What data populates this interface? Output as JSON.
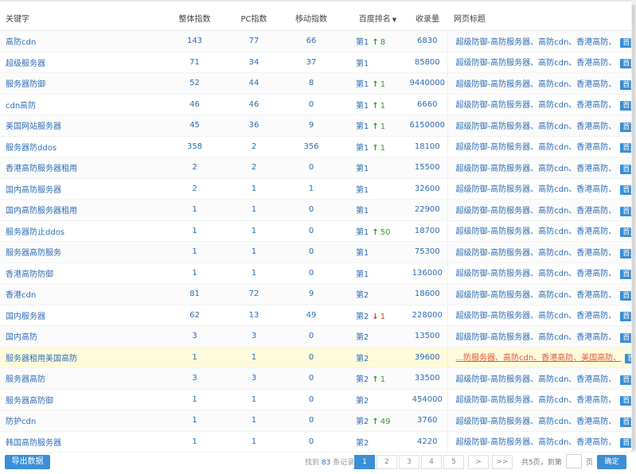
{
  "columns": {
    "keyword": "关键字",
    "total_index": "整体指数",
    "pc_index": "PC指数",
    "mobile_index": "移动指数",
    "baidu_rank": "百度排名",
    "indexed": "收录量",
    "page_title": "网页标题"
  },
  "rows": [
    {
      "kw": "高防cdn",
      "total": "143",
      "pc": "77",
      "mobile": "66",
      "rank": "第1",
      "dir": "up",
      "chg": "8",
      "indexed": "6830",
      "title": "超级防御-高防服务器、高防cdn、香港高防、",
      "link": "首页"
    },
    {
      "kw": "超级服务器",
      "total": "71",
      "pc": "34",
      "mobile": "37",
      "rank": "第1",
      "dir": "",
      "chg": "",
      "indexed": "85800",
      "title": "超级防御-高防服务器、高防cdn、香港高防、",
      "link": "首页"
    },
    {
      "kw": "服务器防御",
      "total": "52",
      "pc": "44",
      "mobile": "8",
      "rank": "第1",
      "dir": "up",
      "chg": "1",
      "indexed": "9440000",
      "title": "超级防御-高防服务器、高防cdn、香港高防、",
      "link": "首页"
    },
    {
      "kw": "cdn高防",
      "total": "46",
      "pc": "46",
      "mobile": "0",
      "rank": "第1",
      "dir": "up",
      "chg": "1",
      "indexed": "6660",
      "title": "超级防御-高防服务器、高防cdn、香港高防、",
      "link": "首页"
    },
    {
      "kw": "美国网站服务器",
      "total": "45",
      "pc": "36",
      "mobile": "9",
      "rank": "第1",
      "dir": "up",
      "chg": "1",
      "indexed": "6150000",
      "title": "超级防御-高防服务器、高防cdn、香港高防、",
      "link": "首页"
    },
    {
      "kw": "服务器防ddos",
      "total": "358",
      "pc": "2",
      "mobile": "356",
      "rank": "第1",
      "dir": "up",
      "chg": "1",
      "indexed": "18100",
      "title": "超级防御-高防服务器、高防cdn、香港高防、",
      "link": "首页"
    },
    {
      "kw": "香港高防服务器租用",
      "total": "2",
      "pc": "2",
      "mobile": "0",
      "rank": "第1",
      "dir": "",
      "chg": "",
      "indexed": "15500",
      "title": "超级防御-高防服务器、高防cdn、香港高防、",
      "link": "首页"
    },
    {
      "kw": "国内高防服务器",
      "total": "2",
      "pc": "1",
      "mobile": "1",
      "rank": "第1",
      "dir": "",
      "chg": "",
      "indexed": "32600",
      "title": "超级防御-高防服务器、高防cdn、香港高防、",
      "link": "首页"
    },
    {
      "kw": "国内高防服务器租用",
      "total": "1",
      "pc": "1",
      "mobile": "0",
      "rank": "第1",
      "dir": "",
      "chg": "",
      "indexed": "22900",
      "title": "超级防御-高防服务器、高防cdn、香港高防、",
      "link": "首页"
    },
    {
      "kw": "服务器防止ddos",
      "total": "1",
      "pc": "1",
      "mobile": "0",
      "rank": "第1",
      "dir": "up",
      "chg": "50",
      "indexed": "18700",
      "title": "超级防御-高防服务器、高防cdn、香港高防、",
      "link": "首页"
    },
    {
      "kw": "服务器高防服务",
      "total": "1",
      "pc": "1",
      "mobile": "0",
      "rank": "第1",
      "dir": "",
      "chg": "",
      "indexed": "75300",
      "title": "超级防御-高防服务器、高防cdn、香港高防、",
      "link": "首页"
    },
    {
      "kw": "香港高防防御",
      "total": "1",
      "pc": "1",
      "mobile": "0",
      "rank": "第1",
      "dir": "",
      "chg": "",
      "indexed": "136000",
      "title": "超级防御-高防服务器、高防cdn、香港高防、",
      "link": "首页"
    },
    {
      "kw": "香港cdn",
      "total": "81",
      "pc": "72",
      "mobile": "9",
      "rank": "第2",
      "dir": "",
      "chg": "",
      "indexed": "18600",
      "title": "超级防御-高防服务器、高防cdn、香港高防、",
      "link": "首页"
    },
    {
      "kw": "国内服务器",
      "total": "62",
      "pc": "13",
      "mobile": "49",
      "rank": "第2",
      "dir": "down",
      "chg": "1",
      "indexed": "228000",
      "title": "超级防御-高防服务器、高防cdn、香港高防、",
      "link": "首页"
    },
    {
      "kw": "国内高防",
      "total": "3",
      "pc": "3",
      "mobile": "0",
      "rank": "第2",
      "dir": "",
      "chg": "",
      "indexed": "13500",
      "title": "超级防御-高防服务器、高防cdn、香港高防、",
      "link": "首页"
    },
    {
      "kw": "服务器租用美国高防",
      "total": "1",
      "pc": "1",
      "mobile": "0",
      "rank": "第2",
      "dir": "",
      "chg": "",
      "indexed": "39600",
      "title": "...防服务器、高防cdn、香港高防、美国高防、",
      "link": "首页",
      "highlight": true
    },
    {
      "kw": "服务器高防",
      "total": "3",
      "pc": "3",
      "mobile": "0",
      "rank": "第2",
      "dir": "up",
      "chg": "1",
      "indexed": "33500",
      "title": "超级防御-高防服务器、高防cdn、香港高防、",
      "link": "首页"
    },
    {
      "kw": "服务器高防御",
      "total": "1",
      "pc": "1",
      "mobile": "0",
      "rank": "第2",
      "dir": "",
      "chg": "",
      "indexed": "454000",
      "title": "超级防御-高防服务器、高防cdn、香港高防、",
      "link": "首页"
    },
    {
      "kw": "防护cdn",
      "total": "1",
      "pc": "1",
      "mobile": "0",
      "rank": "第2",
      "dir": "up",
      "chg": "49",
      "indexed": "3760",
      "title": "超级防御-高防服务器、高防cdn、香港高防、",
      "link": "首页"
    },
    {
      "kw": "韩国高防服务器",
      "total": "1",
      "pc": "1",
      "mobile": "0",
      "rank": "第2",
      "dir": "",
      "chg": "",
      "indexed": "4220",
      "title": "超级防御-高防服务器、高防cdn、香港高防、",
      "link": "首页"
    }
  ],
  "footer": {
    "export_label": "导出数据",
    "found_prefix": "找到",
    "found_count": "83",
    "found_suffix": "条记录",
    "pages": [
      "1",
      "2",
      "3",
      "4",
      "5",
      ">",
      ">>"
    ],
    "active_page": "1",
    "total_pages_text": "共5页，到第",
    "page_word": "页",
    "goto_value": "",
    "confirm_label": "确定"
  },
  "icons": {
    "sort": "sort-desc-icon",
    "rank_up": "arrow-up-icon",
    "rank_down": "arrow-down-icon"
  },
  "colors": {
    "accent": "#3a8fd6",
    "link": "#2d6cb4",
    "up": "#2e9b2e",
    "down": "#d83a3a",
    "highlight_row": "#fdfbdc",
    "highlight_text": "#e4543a"
  }
}
